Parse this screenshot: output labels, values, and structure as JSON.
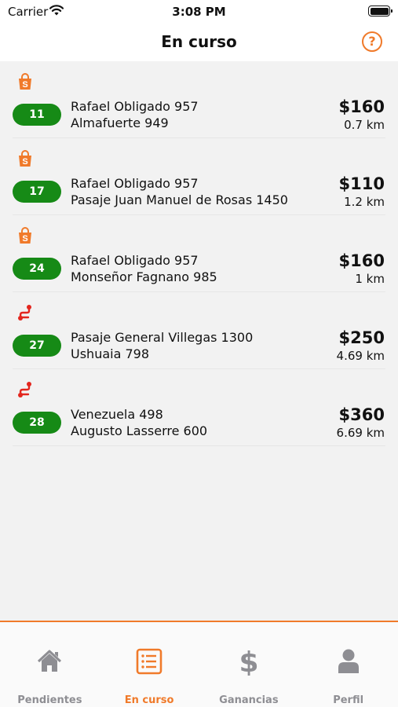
{
  "status_bar": {
    "carrier": "Carrier",
    "time": "3:08 PM"
  },
  "nav": {
    "title": "En curso",
    "help_symbol": "?"
  },
  "colors": {
    "accent": "#f07a2a",
    "badge_green": "#168a16",
    "route_red": "#e3261e",
    "inactive_tab": "#8e8e93"
  },
  "orders": [
    {
      "type_icon": "shopping-bag-icon",
      "number": "11",
      "pickup": "Rafael Obligado 957",
      "dropoff": "Almafuerte 949",
      "price": "$160",
      "distance": "0.7 km"
    },
    {
      "type_icon": "shopping-bag-icon",
      "number": "17",
      "pickup": "Rafael Obligado 957",
      "dropoff": "Pasaje Juan Manuel de Rosas 1450",
      "price": "$110",
      "distance": "1.2 km"
    },
    {
      "type_icon": "shopping-bag-icon",
      "number": "24",
      "pickup": "Rafael Obligado 957",
      "dropoff": "Monseñor Fagnano 985",
      "price": "$160",
      "distance": "1 km"
    },
    {
      "type_icon": "route-icon",
      "number": "27",
      "pickup": "Pasaje General Villegas 1300",
      "dropoff": "Ushuaia 798",
      "price": "$250",
      "distance": "4.69 km"
    },
    {
      "type_icon": "route-icon",
      "number": "28",
      "pickup": "Venezuela 498",
      "dropoff": "Augusto Lasserre 600",
      "price": "$360",
      "distance": "6.69 km"
    }
  ],
  "tabs": [
    {
      "label": "Pendientes",
      "icon": "home-icon",
      "active": false
    },
    {
      "label": "En curso",
      "icon": "list-icon",
      "active": true
    },
    {
      "label": "Ganancias",
      "icon": "dollar-icon",
      "active": false
    },
    {
      "label": "Perfil",
      "icon": "person-icon",
      "active": false
    }
  ]
}
